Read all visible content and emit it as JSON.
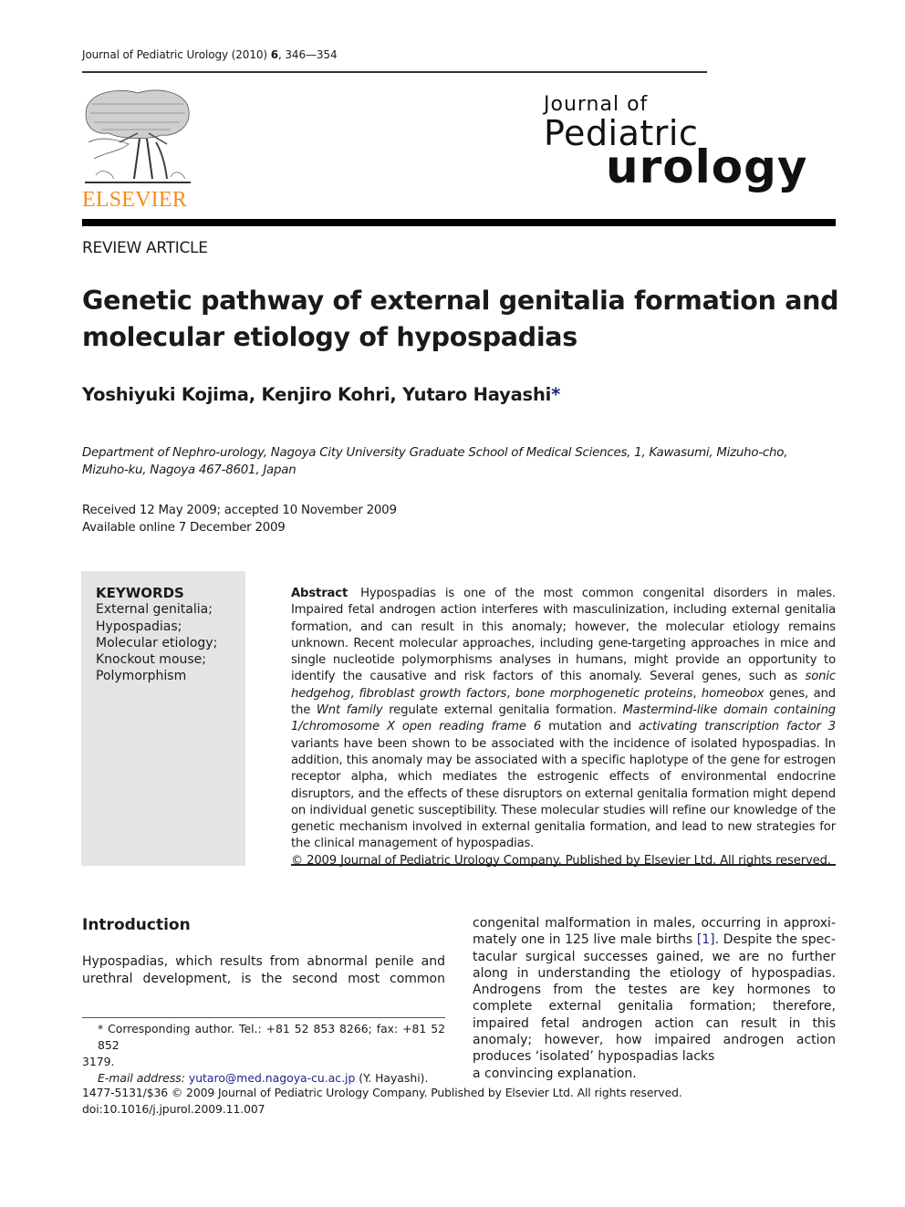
{
  "header": {
    "citation_journal": "Journal of Pediatric Urology (2010)",
    "citation_volume": "6",
    "citation_pages": ", 346—354",
    "publisher_logo_text": "ELSEVIER",
    "journal_logo": {
      "line1": "Journal of",
      "line2": "Pediatric",
      "line3": "urology"
    }
  },
  "article": {
    "section_type": "REVIEW ARTICLE",
    "title_line1": "Genetic pathway of external genitalia formation and",
    "title_line2": "molecular etiology of hypospadias",
    "authors": "Yoshiyuki Kojima, Kenjiro Kohri, Yutaro Hayashi",
    "corresponding_mark": "*",
    "affiliation_line1": "Department of Nephro-urology, Nagoya City University Graduate School of Medical Sciences, 1, Kawasumi, Mizuho-cho,",
    "affiliation_line2": "Mizuho-ku, Nagoya 467-8601, Japan",
    "received": "Received 12 May 2009; accepted 10 November 2009",
    "available": "Available online 7 December 2009"
  },
  "keywords": {
    "title": "KEYWORDS",
    "items": [
      "External genitalia;",
      "Hypospadias;",
      "Molecular etiology;",
      "Knockout mouse;",
      "Polymorphism"
    ]
  },
  "abstract": {
    "label": "Abstract",
    "s1": "Hypospadias is one of the most common congenital disorders in males. Impaired fetal androgen action interferes with masculinization, including external genitalia formation, and can result in this anomaly; however, the molecular etiology remains unknown. Recent molecular approaches, including gene-targeting approaches in mice and single nucleotide polymorphisms analyses in humans, might provide an opportunity to identify the causative and risk factors of this anomaly. Several genes, such as ",
    "i1": "sonic hedgehog",
    "s2": ", ",
    "i2": "fibroblast growth factors",
    "s3": ", ",
    "i3": "bone morphogenetic proteins",
    "s4": ", ",
    "i4": "homeobox",
    "s5": " genes, and the ",
    "i5": "Wnt family",
    "s6": " regulate external genitalia formation. ",
    "i6": "Mastermind-like domain containing 1/chromosome X open reading frame 6",
    "s7": " mutation and ",
    "i7": "activating transcription factor 3",
    "s8": " variants have been shown to be associated with the incidence of isolated hypospadias. In addition, this anomaly may be associated with a specific haplotype of the gene for estrogen receptor alpha, which mediates the estrogenic effects of environmental endocrine disruptors, and the effects of these disruptors on external genitalia formation might depend on individual genetic susceptibility. These molecular studies will refine our knowledge of the genetic mechanism involved in external genitalia formation, and lead to new strategies for the clinical management of hypospadias.",
    "copyright": "© 2009 Journal of Pediatric Urology Company. Published by Elsevier Ltd. All rights reserved."
  },
  "body": {
    "intro_heading": "Introduction",
    "left_para": "Hypospadias, which results from abnormal penile and urethral development, is the second most common",
    "right_p1": "congenital malformation in males, occurring in approxi-mately one in 125 live male births ",
    "right_ref": "[1]",
    "right_p2": ". Despite the spec-tacular surgical successes gained, we are no further along in understanding the etiology of hypospadias. Androgens from the testes are key hormones to complete external genitalia formation; therefore, impaired fetal androgen action can result in this anomaly; however, how impaired androgen action produces ‘isolated’ hypospadias lacks",
    "right_last": "a convincing explanation."
  },
  "footnote": {
    "line1": "* Corresponding author. Tel.: +81 52 853 8266; fax: +81 52 852",
    "line2": "3179.",
    "email_label": "E-mail address:",
    "email": "yutaro@med.nagoya-cu.ac.jp",
    "email_suffix": " (Y. Hayashi)."
  },
  "footer": {
    "issn_line": "1477-5131/$36 © 2009 Journal of Pediatric Urology Company. Published by Elsevier Ltd. All rights reserved.",
    "doi": "doi:10.1016/j.jpurol.2009.11.007"
  },
  "colors": {
    "elsevier_orange": "#f28c1e",
    "link_blue": "#1c2580",
    "keyword_box_bg": "#e4e4e4"
  }
}
